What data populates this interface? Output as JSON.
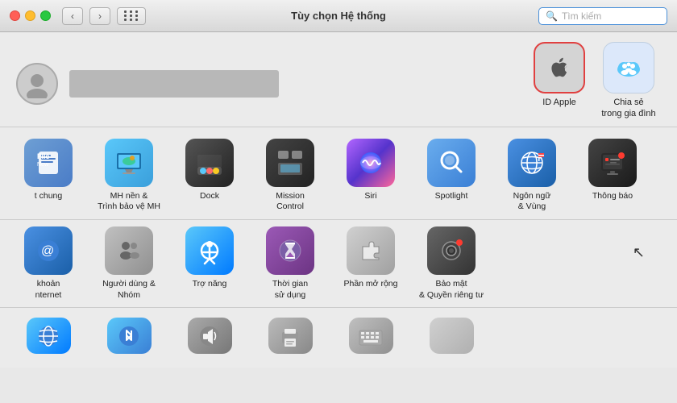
{
  "titlebar": {
    "title": "Tùy chọn Hệ thống",
    "search_placeholder": "Tìm kiếm",
    "nav_back": "‹",
    "nav_forward": "›"
  },
  "profile": {
    "avatar_char": "👤"
  },
  "top_icons": [
    {
      "id": "apple-id",
      "label": "ID Apple",
      "highlighted": true,
      "color": "#d0d0d0"
    },
    {
      "id": "family-sharing",
      "label": "Chia sẻ\ntrong gia đình",
      "highlighted": false,
      "color": "#e8f0ff"
    }
  ],
  "grid_icons": [
    {
      "id": "general",
      "label": "t chung",
      "color": "#4a90e2",
      "icon": "file"
    },
    {
      "id": "desktop",
      "label": "MH nền &\nTrình bảo vệ MH",
      "color": "#5ac8fa",
      "icon": "desktop"
    },
    {
      "id": "dock",
      "label": "Dock",
      "color": "#2c2c2c",
      "icon": "dock"
    },
    {
      "id": "mission-control",
      "label": "Mission\nControl",
      "color": "#2c2c2c",
      "icon": "mission"
    },
    {
      "id": "siri",
      "label": "Siri",
      "color": "#ff6b9d",
      "icon": "siri"
    },
    {
      "id": "spotlight",
      "label": "Spotlight",
      "color": "#4a90e2",
      "icon": "spotlight"
    },
    {
      "id": "language",
      "label": "Ngôn ngữ\n& Vùng",
      "color": "#4a90e2",
      "icon": "language"
    },
    {
      "id": "notifications",
      "label": "Thông báo",
      "color": "#2c2c2c",
      "icon": "notifications"
    },
    {
      "id": "internet",
      "label": "khoản\nnternet",
      "color": "#4a90e2",
      "icon": "internet"
    },
    {
      "id": "users",
      "label": "Người dùng &\nNhóm",
      "color": "#aaa",
      "icon": "users"
    },
    {
      "id": "accessibility",
      "label": "Trợ năng",
      "color": "#4a90e2",
      "icon": "accessibility"
    },
    {
      "id": "screentime",
      "label": "Thời gian\nsử dụng",
      "color": "#7b5ea7",
      "icon": "screentime"
    },
    {
      "id": "extensions",
      "label": "Phần mở rộng",
      "color": "#d0d0d0",
      "icon": "extensions"
    },
    {
      "id": "security",
      "label": "Bảo mật\n& Quyền riêng tư",
      "color": "#555",
      "icon": "security"
    }
  ],
  "bottom_icons": [
    {
      "id": "network",
      "label": "",
      "color": "#5ac8fa"
    },
    {
      "id": "bluetooth",
      "label": "",
      "color": "#4a90e2"
    },
    {
      "id": "sound",
      "label": "",
      "color": "#888"
    },
    {
      "id": "print",
      "label": "",
      "color": "#888"
    },
    {
      "id": "keyboard",
      "label": "",
      "color": "#aaa"
    }
  ],
  "colors": {
    "highlight_border": "#e04040",
    "selected_bg": "#d8d8d8",
    "titlebar_bg": "#ececec",
    "search_border": "#4a90d9"
  }
}
